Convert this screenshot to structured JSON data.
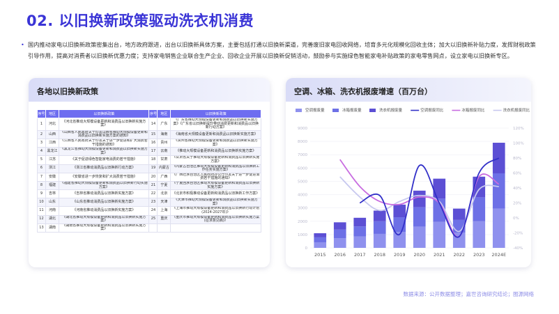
{
  "page_title": "02. 以旧换新政策驱动洗衣机消费",
  "intro_text": "国内推动家电以旧换新政策密集出台，地方政府跟进，出台以旧换新具体方案，主要包括打通以旧换新渠道，完善废旧家电回收网络，培育多元化规模化回收主体；加大以旧换新补贴力度，发挥财税政策引导作用，提高对消费者以旧换新优惠力度；支持家电销售企业联合生产企业、回收企业开展以旧换新促销活动，鼓励参与实施绿色智能家电补贴政策的家电零售网点，设立家电以旧换新专区。",
  "left_card": {
    "title": "各地以旧换新政策",
    "headers": [
      "序号",
      "地区",
      "以旧换新政策",
      "序号",
      "地区",
      "以旧换新政策"
    ],
    "rows": [
      [
        "1",
        "河北",
        "《河北省推动大规模设备更新和消费品以旧换新实施方案》",
        "14",
        "广东",
        "《广东省推动大规模设备更新和消费品以旧换新实施方案》《广东省以旧换新提升带动消费更新和消费品以旧换新行动方案》"
      ],
      [
        "2",
        "山西",
        "《山西省人民政府关于印发山西省推动大规模设备更新和消费品以旧换新实施方案的通知》",
        "15",
        "海南",
        "《海南省大规模设备更新和消费品以旧换新实施方案》"
      ],
      [
        "3",
        "江西",
        "《江西省人民政府关于印发关于进一步促进和扩大消费若干措施的通知》",
        "16",
        "贵州",
        "《贵州省推动大规模设备更新和消费品以旧换新实施方案》"
      ],
      [
        "4",
        "黑龙江",
        "《黑龙江省推动大规模设备更新和消费品以旧换新实施方案》",
        "17",
        "云南",
        "《推动大规模设备更新和消费品以旧换新实施方案》"
      ],
      [
        "5",
        "江苏",
        "《关于促进绿色智能家电消费的若干措施》",
        "18",
        "甘肃",
        "《甘肃省关于推动大规模设备更新和消费品以旧换新实施方案》"
      ],
      [
        "6",
        "浙江",
        "《浙江省推动消费品以旧换新行动方案》",
        "19",
        "内蒙古",
        "《内蒙古自治区推动大规模设备更新和消费品以旧换新工作任务实施方案》"
      ],
      [
        "7",
        "安徽",
        "《安徽省进一步恢复和扩大消费若干措施》",
        "20",
        "广西",
        "《广西壮族自治区人民政府办公厅印发关于进一步促进消费若干措施的通知》"
      ],
      [
        "8",
        "福建",
        "《福建省推动大规模设备更新和消费品以旧换新行动实施方案》",
        "21",
        "宁夏",
        "《宁夏回族自治区推动大规模设备更新和消费品以旧换新实施方案》"
      ],
      [
        "9",
        "吉林",
        "《吉林省推动消费品以旧换新实施方案》",
        "22",
        "北京",
        "《北京市积极推动设备更新和消费品以旧换新工作方案》"
      ],
      [
        "10",
        "山东",
        "《山东省推动消费品以旧换新实施方案》",
        "23",
        "天津",
        "《天津市推动大规模设备更新和消费品以旧换新实施方案》"
      ],
      [
        "11",
        "河南",
        "《河南省推动消费品以旧换新实施方案》",
        "24",
        "上海",
        "《上海市推动大规模设备更新和消费品以旧换新行动计划(2024-2027年)》"
      ],
      [
        "12",
        "湖北",
        "《湖北省推动大规模设备更新和消费品以旧换新实施方案》",
        "25",
        "重庆",
        "《重庆市推动大规模设备更新和消费品以旧换新实施方案(征求意见稿)》"
      ],
      [
        "13",
        "湖南",
        "《湖南省推动大规模设备更新和消费品以旧换新实施方案》",
        "",
        "",
        ""
      ]
    ]
  },
  "right_card": {
    "title": "空调、冰箱、洗衣机报废增速（百万台）"
  },
  "chart_data": {
    "type": "bar",
    "title": "空调、冰箱、洗衣机报废增速（百万台）",
    "categories": [
      "2015",
      "2016",
      "2017",
      "2018",
      "2019",
      "2020",
      "2021",
      "2022",
      "2023",
      "2024E"
    ],
    "ylim": [
      0,
      9000
    ],
    "yticks": [
      "0",
      "1000",
      "2000",
      "3000",
      "4000",
      "5000",
      "6000",
      "7000",
      "8000",
      "9000"
    ],
    "y2lim": [
      -40,
      120
    ],
    "y2ticks": [
      "-40%",
      "-20%",
      "0%",
      "20%",
      "40%",
      "60%",
      "80%",
      "100%",
      "120%"
    ],
    "legend_position": "top",
    "series": [
      {
        "name": "空调报废量",
        "kind": "bar",
        "color": "#8f91ee",
        "values": [
          420,
          720,
          850,
          1050,
          1200,
          1600,
          1950,
          1150,
          2000,
          2950
        ]
      },
      {
        "name": "冰箱报废量",
        "kind": "bar",
        "color": "#6d70e6",
        "values": [
          370,
          650,
          760,
          950,
          1100,
          1450,
          1750,
          950,
          1800,
          2650
        ]
      },
      {
        "name": "洗衣机报废量",
        "kind": "bar",
        "color": "#5c4fd4",
        "values": [
          310,
          550,
          650,
          800,
          950,
          1250,
          1500,
          850,
          1550,
          2300
        ]
      },
      {
        "name": "空调报废同比",
        "kind": "line",
        "color": "#3230c8",
        "values": [
          null,
          null,
          20,
          30,
          -22,
          70,
          20,
          -25,
          60,
          80
        ]
      },
      {
        "name": "冰箱报废同比",
        "kind": "line",
        "color": "#c86ce0",
        "values": [
          null,
          78,
          42,
          22,
          18,
          28,
          20,
          -25,
          55,
          45
        ]
      },
      {
        "name": "洗衣机报废同比",
        "kind": "line",
        "color": "#c7c8ef",
        "values": [
          null,
          55,
          28,
          10,
          22,
          30,
          22,
          -18,
          38,
          42
        ]
      }
    ]
  },
  "source_text": "数据来源：公开数据整理；嘉世咨询研究结论；图源网络"
}
